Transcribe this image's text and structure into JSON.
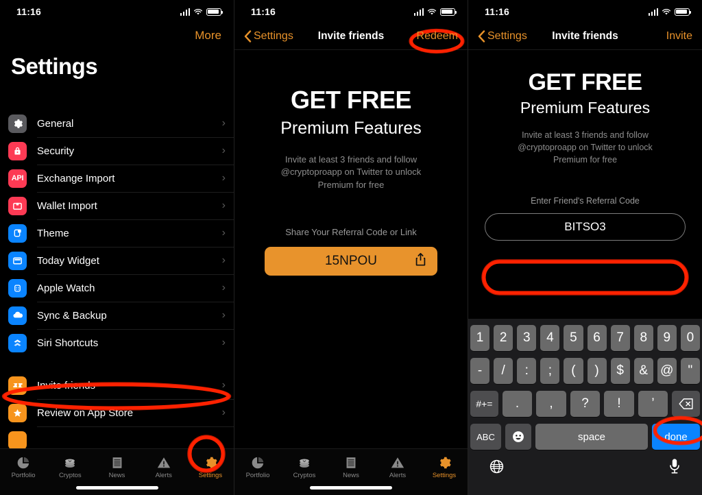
{
  "status_bar": {
    "time": "11:16"
  },
  "colors": {
    "accent_orange": "#e8922a",
    "code_button": "#e8932c",
    "annotation_red": "#ff2200",
    "done_blue": "#0a84ff",
    "icon_red": "#ff2d55",
    "icon_blue": "#0a84ff"
  },
  "panel1": {
    "more_label": "More",
    "page_title": "Settings",
    "items": [
      {
        "label": "General",
        "icon": "gear-icon",
        "icon_color": "#5a5a5e"
      },
      {
        "label": "Security",
        "icon": "lock-icon",
        "icon_color": "#fd3a54"
      },
      {
        "label": "Exchange Import",
        "icon": "api-icon",
        "icon_color": "#fd3a54",
        "icon_text": "API"
      },
      {
        "label": "Wallet Import",
        "icon": "wallet-icon",
        "icon_color": "#fd3a54"
      },
      {
        "label": "Theme",
        "icon": "theme-icon",
        "icon_color": "#0a84ff"
      },
      {
        "label": "Today Widget",
        "icon": "widget-icon",
        "icon_color": "#0a84ff"
      },
      {
        "label": "Apple Watch",
        "icon": "apple-watch-icon",
        "icon_color": "#0a84ff"
      },
      {
        "label": "Sync & Backup",
        "icon": "cloud-icon",
        "icon_color": "#0a84ff"
      },
      {
        "label": "Siri Shortcuts",
        "icon": "shortcuts-icon",
        "icon_color": "#0a84ff"
      }
    ],
    "items2": [
      {
        "label": "Invite friends",
        "icon": "ticket-icon",
        "icon_color": "#f7941d"
      },
      {
        "label": "Review on App Store",
        "icon": "star-icon",
        "icon_color": "#f7941d"
      }
    ],
    "chevron": "›"
  },
  "tabbar": {
    "items": [
      {
        "label": "Portfolio",
        "icon": "pie-chart-icon"
      },
      {
        "label": "Cryptos",
        "icon": "coins-icon"
      },
      {
        "label": "News",
        "icon": "document-icon"
      },
      {
        "label": "Alerts",
        "icon": "warning-icon"
      },
      {
        "label": "Settings",
        "icon": "gear-icon"
      }
    ],
    "active": "Settings"
  },
  "panel2": {
    "nav": {
      "back_label": "Settings",
      "title": "Invite friends",
      "action_label": "Redeem"
    },
    "promo": {
      "headline": "GET FREE",
      "subhead": "Premium Features",
      "body": "Invite at least 3 friends and follow @cryptoproapp on Twitter to unlock Premium for free"
    },
    "share": {
      "label": "Share Your Referral Code or Link",
      "code": "15NPOU",
      "share_icon": "share-icon"
    }
  },
  "panel3": {
    "nav": {
      "back_label": "Settings",
      "title": "Invite friends",
      "action_label": "Invite"
    },
    "promo": {
      "headline": "GET FREE",
      "subhead": "Premium Features",
      "body": "Invite at least 3 friends and follow @cryptoproapp on Twitter to unlock Premium for free"
    },
    "referral": {
      "label": "Enter Friend's Referral Code",
      "value": "BITSO3"
    },
    "keyboard": {
      "row1": [
        "1",
        "2",
        "3",
        "4",
        "5",
        "6",
        "7",
        "8",
        "9",
        "0"
      ],
      "row2": [
        "-",
        "/",
        ":",
        ";",
        "(",
        ")",
        "$",
        "&",
        "@",
        "\""
      ],
      "row3": {
        "mod": "#+=",
        "keys": [
          ".",
          ",",
          "?",
          "!",
          "’"
        ],
        "backspace": "backspace-icon"
      },
      "row4": {
        "abc": "ABC",
        "emoji": "emoji-icon",
        "space": "space",
        "done": "done"
      },
      "bottom": {
        "globe": "globe-icon",
        "mic": "microphone-icon"
      }
    }
  },
  "annotations": [
    {
      "target": "invite-friends-row",
      "shape": "ellipse"
    },
    {
      "target": "settings-tab",
      "shape": "circle"
    },
    {
      "target": "redeem-button",
      "shape": "ellipse"
    },
    {
      "target": "referral-code-input",
      "shape": "ellipse"
    },
    {
      "target": "done-key",
      "shape": "ellipse"
    }
  ]
}
